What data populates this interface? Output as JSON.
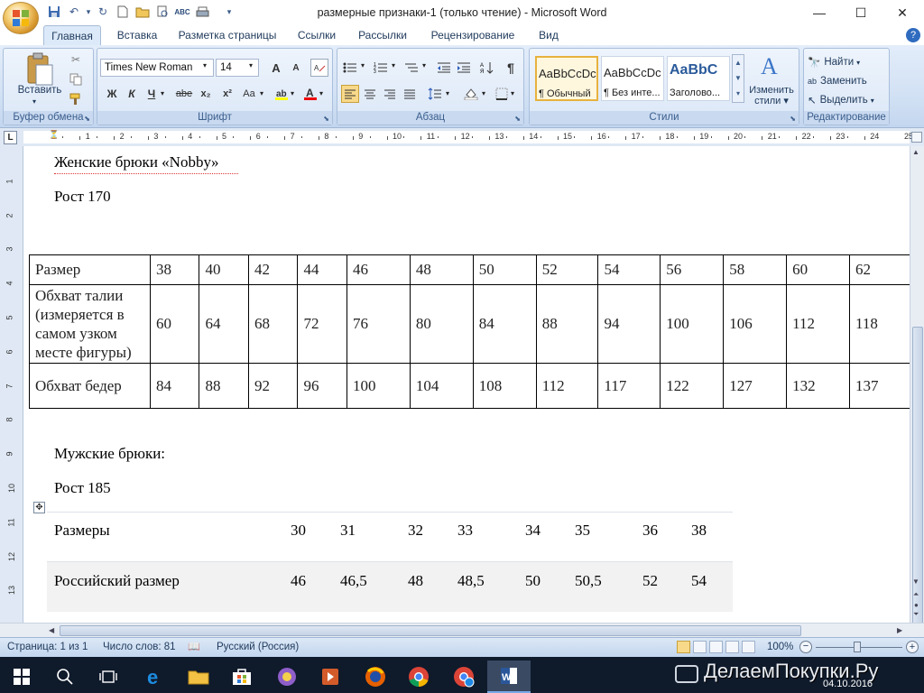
{
  "window": {
    "title": "размерные признаки-1 (только чтение)  -  Microsoft Word",
    "minimize": "—",
    "maximize": "☐",
    "close": "✕"
  },
  "quick_access": {
    "save_icon": "save-icon",
    "undo_icon": "undo-icon",
    "redo_icon": "redo-icon"
  },
  "tabs": [
    "Главная",
    "Вставка",
    "Разметка страницы",
    "Ссылки",
    "Рассылки",
    "Рецензирование",
    "Вид"
  ],
  "active_tab": "Главная",
  "ribbon": {
    "clipboard": {
      "paste_label": "Вставить",
      "group_label": "Буфер обмена"
    },
    "font": {
      "font_name": "Times New Roman",
      "font_size": "14",
      "bold": "Ж",
      "italic": "К",
      "underline": "Ч",
      "strike": "abe",
      "sub": "x₂",
      "sup": "x²",
      "case": "Аа",
      "grow": "A",
      "shrink": "A",
      "group_label": "Шрифт"
    },
    "paragraph": {
      "group_label": "Абзац",
      "pilcrow": "¶"
    },
    "styles": {
      "items": [
        {
          "preview": "AaBbCcDc",
          "name": "¶ Обычный"
        },
        {
          "preview": "AaBbCcDc",
          "name": "¶ Без инте..."
        },
        {
          "preview": "AaBbC",
          "name": "Заголово..."
        }
      ],
      "change_label_1": "Изменить",
      "change_label_2": "стили",
      "group_label": "Стили"
    },
    "editing": {
      "find": "Найти",
      "replace": "Заменить",
      "select": "Выделить",
      "group_label": "Редактирование"
    }
  },
  "ruler": {
    "numbers": [
      "1",
      "2",
      "3",
      "4",
      "5",
      "6",
      "7",
      "8",
      "9",
      "10",
      "11",
      "12",
      "13",
      "14",
      "15",
      "16",
      "17",
      "18",
      "19",
      "20",
      "21",
      "22",
      "23",
      "24",
      "25"
    ],
    "vnumbers": [
      "1",
      "2",
      "3",
      "4",
      "5",
      "6",
      "7",
      "8",
      "9",
      "10",
      "11",
      "12",
      "13"
    ]
  },
  "document": {
    "heading1": "Женские брюки «Nobby»",
    "height1": "Рост 170",
    "table1": {
      "rows": [
        {
          "label": "Размер",
          "values": [
            "38",
            "40",
            "42",
            "44",
            "46",
            "48",
            "50",
            "52",
            "54",
            "56",
            "58",
            "60",
            "62"
          ]
        },
        {
          "label": "Обхват талии (измеряется в самом узком месте фигуры)",
          "values": [
            "60",
            "64",
            "68",
            "72",
            "76",
            "80",
            "84",
            "88",
            "94",
            "100",
            "106",
            "112",
            "118"
          ]
        },
        {
          "label": "Обхват бедер",
          "values": [
            "84",
            "88",
            "92",
            "96",
            "100",
            "104",
            "108",
            "112",
            "117",
            "122",
            "127",
            "132",
            "137"
          ]
        }
      ]
    },
    "heading2": "Мужские брюки:",
    "height2": "Рост 185",
    "table2": {
      "rows": [
        {
          "label": "Размеры",
          "values": [
            "30",
            "31",
            "32",
            "33",
            "34",
            "35",
            "36",
            "38"
          ]
        },
        {
          "label": "Российский размер",
          "values": [
            "46",
            "46,5",
            "48",
            "48,5",
            "50",
            "50,5",
            "52",
            "54"
          ]
        }
      ]
    }
  },
  "status": {
    "page": "Страница: 1 из 1",
    "words": "Число слов: 81",
    "language": "Русский (Россия)",
    "zoom": "100%"
  },
  "taskbar": {
    "date": "04.10.2016",
    "watermark": "ДелаемПокупки.Ру"
  }
}
